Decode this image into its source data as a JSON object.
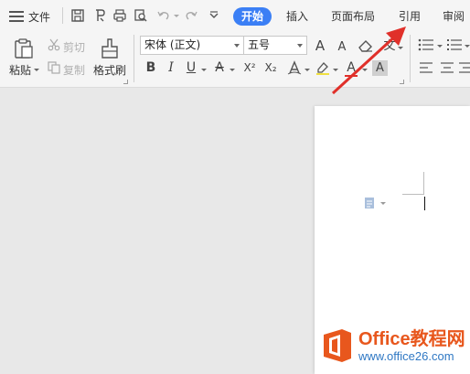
{
  "menubar": {
    "file_label": "文件",
    "tabs": [
      {
        "label": "开始",
        "active": true
      },
      {
        "label": "插入",
        "active": false
      },
      {
        "label": "页面布局",
        "active": false
      },
      {
        "label": "引用",
        "active": false
      },
      {
        "label": "审阅",
        "active": false
      }
    ]
  },
  "ribbon": {
    "paste_label": "粘贴",
    "cut_label": "剪切",
    "copy_label": "复制",
    "format_painter_label": "格式刷",
    "font_name": "宋体 (正文)",
    "font_size": "五号",
    "bold": "B",
    "italic": "I",
    "underline": "U",
    "strikethrough": "A",
    "superscript": "X²",
    "subscript": "X₂",
    "grow_font": "A",
    "shrink_font": "A",
    "phonetic": "文",
    "font_color": "A",
    "char_shading": "A"
  },
  "watermark": {
    "title": "Office教程网",
    "url": "www.office26.com"
  },
  "colors": {
    "accent": "#3b7ff5",
    "annotation": "#e0302a",
    "watermark_orange": "#e8571d",
    "watermark_blue": "#2f78c4"
  }
}
